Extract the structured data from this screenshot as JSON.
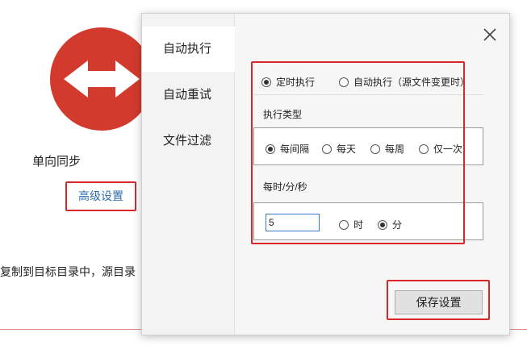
{
  "background": {
    "logo_icon": "bidirectional-arrow-icon",
    "logo_color": "#d23a2d",
    "sync_mode": "单向同步",
    "advanced_link": "高级设置",
    "description": "复制到目标目录中，源目录"
  },
  "dialog": {
    "close_icon": "close-icon",
    "nav": [
      {
        "label": "自动执行",
        "active": true
      },
      {
        "label": "自动重试",
        "active": false
      },
      {
        "label": "文件过滤",
        "active": false
      }
    ],
    "mode": {
      "options": [
        {
          "label": "定时执行",
          "checked": true
        },
        {
          "label": "自动执行（源文件变更时）",
          "checked": false
        }
      ]
    },
    "exec_type": {
      "label": "执行类型",
      "options": [
        {
          "label": "每间隔",
          "checked": true
        },
        {
          "label": "每天",
          "checked": false
        },
        {
          "label": "每周",
          "checked": false
        },
        {
          "label": "仅一次",
          "checked": false
        }
      ]
    },
    "interval": {
      "label": "每时/分/秒",
      "value": "5",
      "units": [
        {
          "label": "时",
          "checked": false
        },
        {
          "label": "分",
          "checked": true
        }
      ]
    },
    "save_label": "保存设置"
  },
  "colors": {
    "highlight": "#d9262b",
    "link": "#2f6fae",
    "input_border": "#3c78c8"
  }
}
